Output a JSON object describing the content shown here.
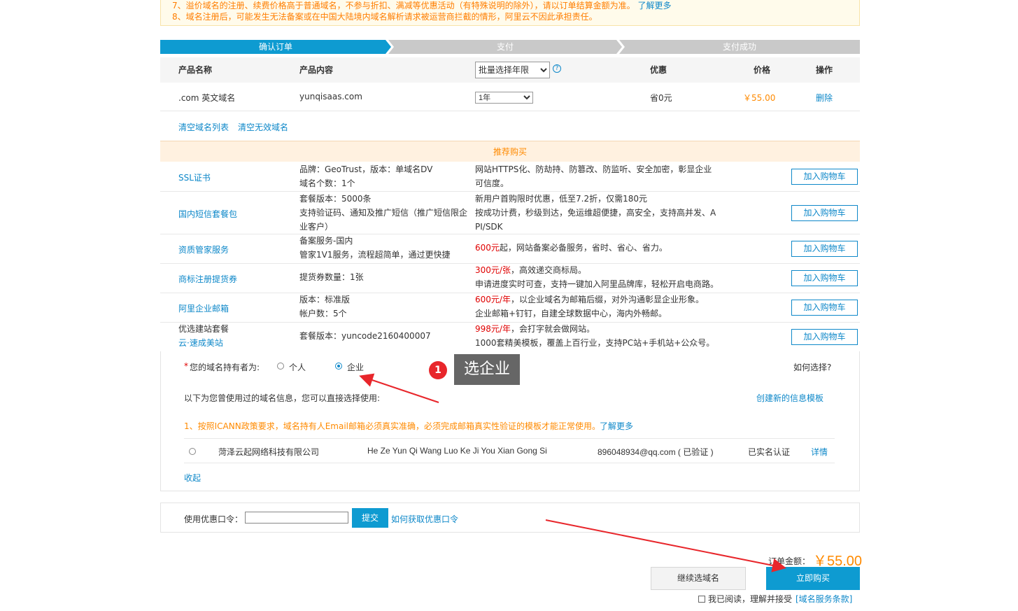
{
  "notice": {
    "line7": "7、溢价域名的注册、续费价格高于普通域名，不参与折扣、满减等优惠活动（有特殊说明的除外），请以订单结算金额为准。",
    "line7_link": "了解更多",
    "line8": "8、域名注册后，可能发生无法备案或在中国大陆境内域名解析请求被运营商拦截的情形，阿里云不因此承担责任。"
  },
  "steps": [
    "确认订单",
    "支付",
    "支付成功"
  ],
  "table": {
    "headers": {
      "name": "产品名称",
      "content": "产品内容",
      "batch_select": "批量选择年限",
      "discount": "优惠",
      "price": "价格",
      "action": "操作"
    },
    "row": {
      "name": ".com 英文域名",
      "content": "yunqisaas.com",
      "year": "1年",
      "discount": "省0元",
      "price": "￥55.00",
      "action": "删除"
    },
    "links": [
      "清空域名列表",
      "清空无效域名"
    ]
  },
  "recommend": {
    "title": "推荐购买",
    "cart_label": "加入购物车",
    "items": [
      {
        "name": "SSL证书",
        "content": [
          "品牌：GeoTrust，版本：单域名DV",
          "域名个数：1个"
        ],
        "desc": [
          "网站HTTPS化、防劫持、防篡改、防监听、安全加密，彰显企业",
          "可信度。"
        ]
      },
      {
        "name": "国内短信套餐包",
        "content": [
          "套餐版本：5000条",
          "支持验证码、通知及推广短信（推广短信限企",
          "业客户）"
        ],
        "desc": [
          "新用户首购限时优惠，低至7.2折，仅需180元",
          "按成功计费，秒级到达，免运维超便捷，高安全，支持高并发、A",
          "PI/SDK"
        ]
      },
      {
        "name": "资质管家服务",
        "content": [
          "备案服务-国内",
          "管家1V1服务，流程超简单，通过更快捷"
        ],
        "desc_red": "600元",
        "desc_rest": "起，网站备案必备服务，省时、省心、省力。"
      },
      {
        "name": "商标注册提货券",
        "content": [
          "提货券数量：1张"
        ],
        "desc_red": "300元/张",
        "desc_rest": "，高效递交商标局。",
        "desc2": "申请进度实时可查，支持一键加入阿里品牌库，轻松开启电商路。"
      },
      {
        "name": "阿里企业邮箱",
        "content": [
          "版本：标准版",
          "帐户数：5个"
        ],
        "desc_red": "600元/年",
        "desc_rest": "，以企业域名为邮箱后缀，对外沟通彰显企业形象。",
        "desc2": "企业邮箱+钉钉，自建全球数据中心，海内外畅邮。"
      },
      {
        "name_plain": "优选建站套餐",
        "name": "云·速成美站",
        "content": [
          "套餐版本：yuncode2160400007"
        ],
        "desc_red": "998元/年",
        "desc_rest": "，会打字就会做网站。",
        "desc2": "1000套精美模板，覆盖上百行业，支持PC站+手机站+公众号。"
      }
    ]
  },
  "holder": {
    "required_mark": "*",
    "label": "您的域名持有者为:",
    "option_personal": "个人",
    "option_enterprise": "企业",
    "how_choose": "如何选择?",
    "used_info": "以下为您曾使用过的域名信息，您可以直接选择使用:",
    "create_template": "创建新的信息模板",
    "icann_note": "1、按照ICANN政策要求，域名持有人Email邮箱必须真实准确，必须完成邮箱真实性验证的模板才能正常使用。",
    "icann_link": "了解更多",
    "template": {
      "company": "菏泽云起网络科技有限公司",
      "pinyin": "He Ze Yun Qi Wang Luo Ke Ji You Xian Gong Si",
      "email": "896048934@qq.com ( 已验证 )",
      "status": "已实名认证",
      "detail": "详情"
    },
    "collapse": "收起"
  },
  "callout": {
    "badge": "1",
    "text": "选企业"
  },
  "coupon": {
    "label": "使用优惠口令：",
    "submit": "提交",
    "how_get": "如何获取优惠口令"
  },
  "order": {
    "total_label": "订单金额：",
    "total_value": "￥55.00",
    "continue": "继续选域名",
    "buy": "立即购买",
    "agree_text": "我已阅读，理解并接受",
    "agree_link": "[域名服务条款]"
  },
  "colors": {
    "accent": "#0e9bd1",
    "link": "#0e88c9",
    "orange": "#ff8a00",
    "annotation_red": "#e8262b"
  }
}
